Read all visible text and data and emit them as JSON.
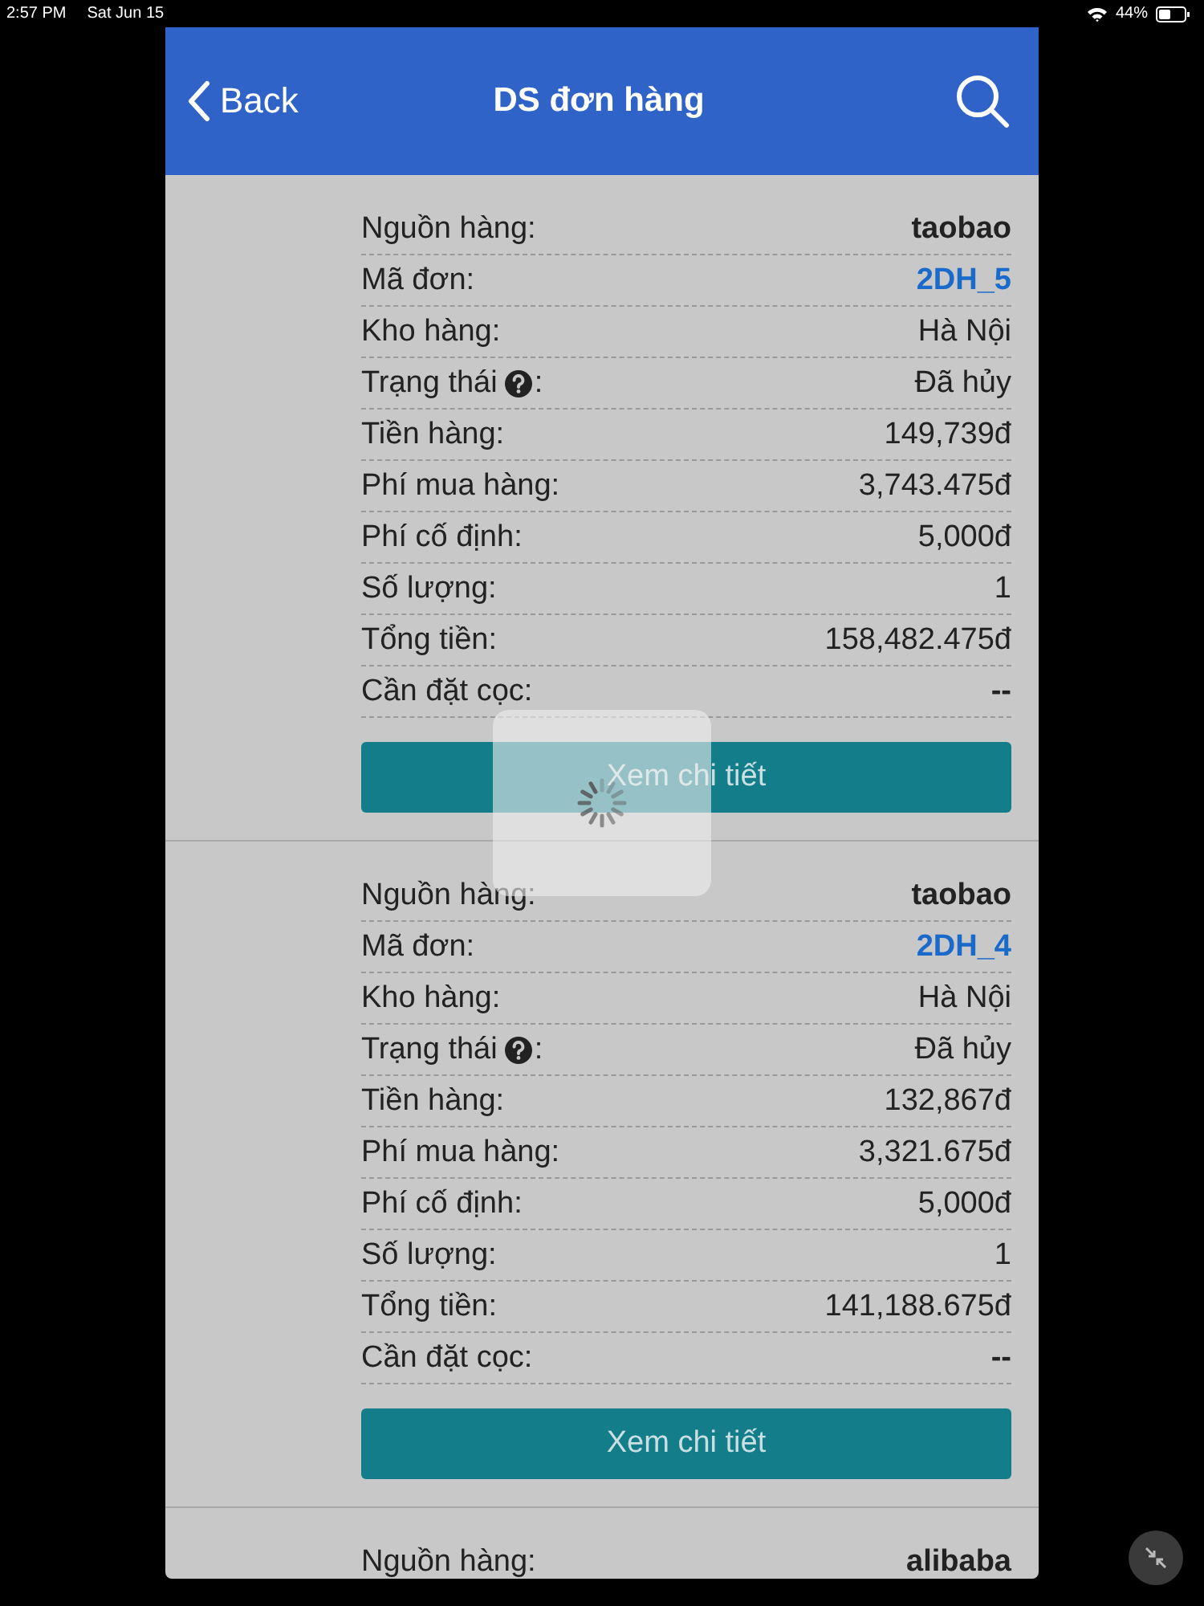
{
  "status_bar": {
    "time": "2:57 PM",
    "date": "Sat Jun 15",
    "battery": "44%"
  },
  "header": {
    "back": "Back",
    "title": "DS đơn hàng"
  },
  "orders": [
    {
      "rows": [
        {
          "label": "Nguồn hàng:",
          "value": "taobao",
          "kind": "bold"
        },
        {
          "label": "Mã đơn:",
          "value": "2DH_5",
          "kind": "link"
        },
        {
          "label": "Kho hàng:",
          "value": "Hà Nội",
          "kind": "plain"
        },
        {
          "label": "Trạng thái",
          "value": "Đã hủy",
          "kind": "plain",
          "help": true,
          "suffix": ":"
        },
        {
          "label": "Tiền hàng:",
          "value": "149,739đ",
          "kind": "plain"
        },
        {
          "label": "Phí mua hàng:",
          "value": "3,743.475đ",
          "kind": "plain"
        },
        {
          "label": "Phí cố định:",
          "value": "5,000đ",
          "kind": "plain"
        },
        {
          "label": "Số lượng:",
          "value": "1",
          "kind": "plain"
        },
        {
          "label": "Tổng tiền:",
          "value": "158,482.475đ",
          "kind": "plain"
        },
        {
          "label": "Cần đặt cọc:",
          "value": "--",
          "kind": "bold"
        }
      ],
      "button": "Xem chi tiết"
    },
    {
      "rows": [
        {
          "label": "Nguồn hàng:",
          "value": "taobao",
          "kind": "bold"
        },
        {
          "label": "Mã đơn:",
          "value": "2DH_4",
          "kind": "link"
        },
        {
          "label": "Kho hàng:",
          "value": "Hà Nội",
          "kind": "plain"
        },
        {
          "label": "Trạng thái",
          "value": "Đã hủy",
          "kind": "plain",
          "help": true,
          "suffix": ":"
        },
        {
          "label": "Tiền hàng:",
          "value": "132,867đ",
          "kind": "plain"
        },
        {
          "label": "Phí mua hàng:",
          "value": "3,321.675đ",
          "kind": "plain"
        },
        {
          "label": "Phí cố định:",
          "value": "5,000đ",
          "kind": "plain"
        },
        {
          "label": "Số lượng:",
          "value": "1",
          "kind": "plain"
        },
        {
          "label": "Tổng tiền:",
          "value": "141,188.675đ",
          "kind": "plain"
        },
        {
          "label": "Cần đặt cọc:",
          "value": "--",
          "kind": "bold"
        }
      ],
      "button": "Xem chi tiết"
    },
    {
      "rows": [
        {
          "label": "Nguồn hàng:",
          "value": "alibaba",
          "kind": "bold"
        }
      ]
    }
  ],
  "loading": true
}
